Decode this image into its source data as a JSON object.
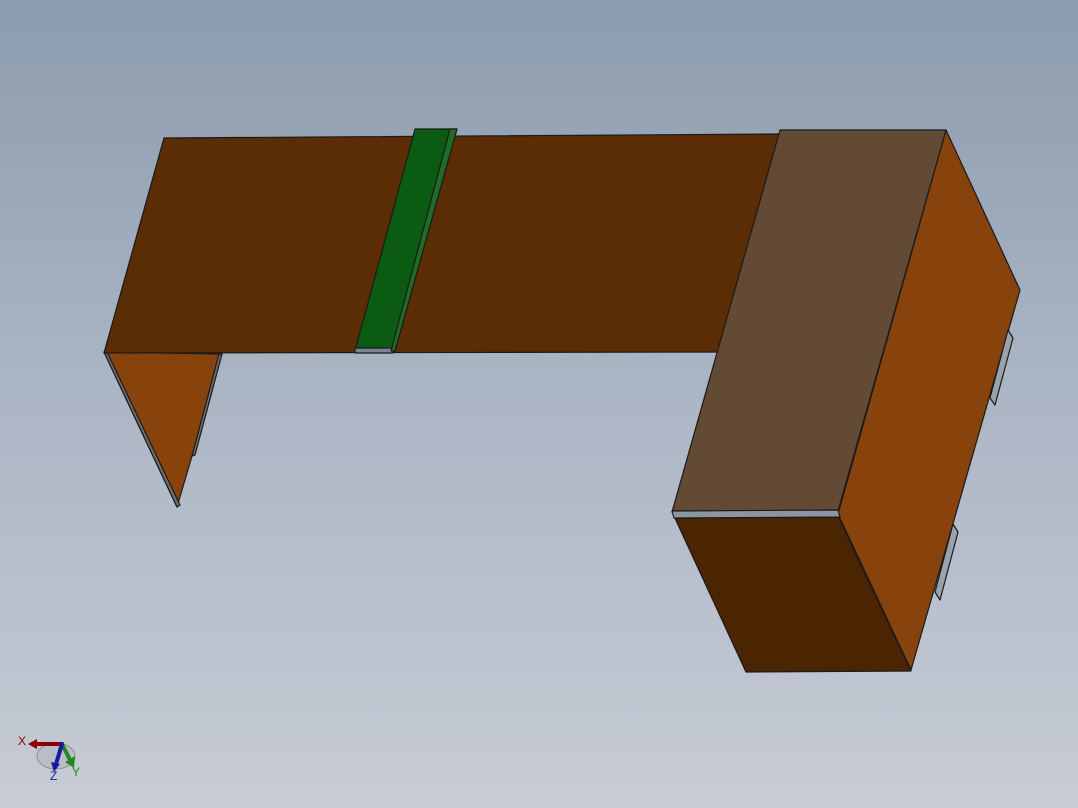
{
  "viewport": {
    "background_top": "#8c9bae",
    "background_bottom": "#c7ccd5"
  },
  "model": {
    "colors": {
      "top_face": "#5a2d04",
      "left_end_face": "#87430b",
      "green_strip": "#0b5b12",
      "cabinet_top": "#634a34",
      "cabinet_side": "#87430b",
      "cabinet_front": "#4b2402",
      "handle": "#9aa2ad",
      "edge": "#1a1a1a"
    }
  },
  "triad": {
    "x_label": "X",
    "y_label": "Y",
    "z_label": "Z",
    "x_color": "#8b0000",
    "y_color": "#1f8a1f",
    "z_color": "#1a1aa0"
  }
}
